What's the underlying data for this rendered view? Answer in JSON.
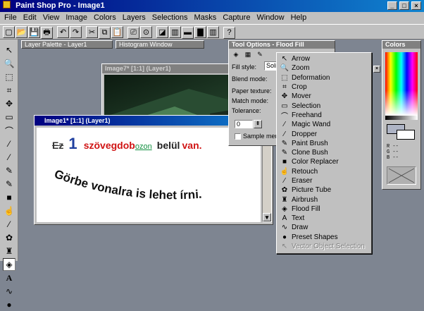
{
  "app": {
    "title": "Paint Shop Pro - Image1"
  },
  "menu": [
    "File",
    "Edit",
    "View",
    "Image",
    "Colors",
    "Layers",
    "Selections",
    "Masks",
    "Capture",
    "Window",
    "Help"
  ],
  "palettes": {
    "layer": "Layer Palette - Layer1",
    "histogram": "Histogram Window",
    "tool_options": "Tool Options - Flood Fill",
    "colors": "Colors"
  },
  "tool_options": {
    "fill_style_label": "Fill style:",
    "fill_style_value": "Solic",
    "blend_mode_label": "Blend mode:",
    "paper_texture_label": "Paper texture:",
    "match_mode_label": "Match mode:",
    "tolerance_label": "Tolerance:",
    "tolerance_value": "0",
    "sample_merged_label": "Sample merg"
  },
  "image7": {
    "title": "Image7* [1:1] (Layer1)"
  },
  "image1": {
    "title": "Image1* [1:1] (Layer1)",
    "line1": {
      "strike": "Ez",
      "num": "1",
      "word1": "szövegdob",
      "link": "ozon",
      "word2": "belül",
      "red": "van."
    },
    "line2": "Görbe vonalra is lehet írni."
  },
  "colors_palette": {
    "r": "R --",
    "g": "G --",
    "b": "B --"
  },
  "context_menu": [
    {
      "icon": "arrow-icon",
      "glyph": "↖",
      "label": "Arrow",
      "enabled": true
    },
    {
      "icon": "zoom-icon",
      "glyph": "🔍",
      "label": "Zoom",
      "enabled": true
    },
    {
      "icon": "deformation-icon",
      "glyph": "⬚",
      "label": "Deformation",
      "enabled": true
    },
    {
      "icon": "crop-icon",
      "glyph": "⌗",
      "label": "Crop",
      "enabled": true
    },
    {
      "icon": "mover-icon",
      "glyph": "✥",
      "label": "Mover",
      "enabled": true
    },
    {
      "icon": "selection-icon",
      "glyph": "▭",
      "label": "Selection",
      "enabled": true
    },
    {
      "icon": "freehand-icon",
      "glyph": "⌒",
      "label": "Freehand",
      "enabled": true
    },
    {
      "icon": "magic-wand-icon",
      "glyph": "⁄",
      "label": "Magic Wand",
      "enabled": true
    },
    {
      "icon": "dropper-icon",
      "glyph": "⁄",
      "label": "Dropper",
      "enabled": true
    },
    {
      "icon": "paint-brush-icon",
      "glyph": "✎",
      "label": "Paint Brush",
      "enabled": true
    },
    {
      "icon": "clone-brush-icon",
      "glyph": "✎",
      "label": "Clone Bush",
      "enabled": true
    },
    {
      "icon": "color-replacer-icon",
      "glyph": "■",
      "label": "Color Replacer",
      "enabled": true
    },
    {
      "icon": "retouch-icon",
      "glyph": "☝",
      "label": "Retouch",
      "enabled": true
    },
    {
      "icon": "eraser-icon",
      "glyph": "⁄",
      "label": "Eraser",
      "enabled": true
    },
    {
      "icon": "picture-tube-icon",
      "glyph": "✿",
      "label": "Picture Tube",
      "enabled": true
    },
    {
      "icon": "airbrush-icon",
      "glyph": "♜",
      "label": "Airbrush",
      "enabled": true
    },
    {
      "icon": "flood-fill-icon",
      "glyph": "◈",
      "label": "Flood Fill",
      "enabled": true
    },
    {
      "icon": "text-icon",
      "glyph": "A",
      "label": "Text",
      "enabled": true
    },
    {
      "icon": "draw-icon",
      "glyph": "∿",
      "label": "Draw",
      "enabled": true
    },
    {
      "icon": "preset-shapes-icon",
      "glyph": "●",
      "label": "Preset Shapes",
      "enabled": true
    },
    {
      "icon": "vector-selection-icon",
      "glyph": "↖",
      "label": "Vector Object Selection",
      "enabled": false
    }
  ],
  "toolbar_icons": [
    "new-icon",
    "open-icon",
    "save-icon",
    "print-icon",
    "undo-icon",
    "redo-icon",
    "cut-icon",
    "copy-icon",
    "paste-icon",
    "capture-icon",
    "browse-icon",
    "tool-palette-icon",
    "palette-icon",
    "color-icon",
    "histogram-icon",
    "layer-icon",
    "help-icon"
  ],
  "left_tools": [
    "arrow-icon",
    "zoom-icon",
    "deformation-icon",
    "crop-icon",
    "mover-icon",
    "selection-icon",
    "freehand-icon",
    "magic-wand-icon",
    "dropper-icon",
    "paint-brush-icon",
    "clone-brush-icon",
    "color-replacer-icon",
    "retouch-icon",
    "eraser-icon",
    "picture-tube-icon",
    "airbrush-icon",
    "flood-fill-icon",
    "text-icon",
    "draw-icon",
    "preset-shapes-icon"
  ],
  "left_glyphs": [
    "↖",
    "🔍",
    "⬚",
    "⌗",
    "✥",
    "▭",
    "⌒",
    "⁄",
    "⁄",
    "✎",
    "✎",
    "■",
    "☝",
    "⁄",
    "✿",
    "♜",
    "◈",
    "A",
    "∿",
    "●"
  ]
}
